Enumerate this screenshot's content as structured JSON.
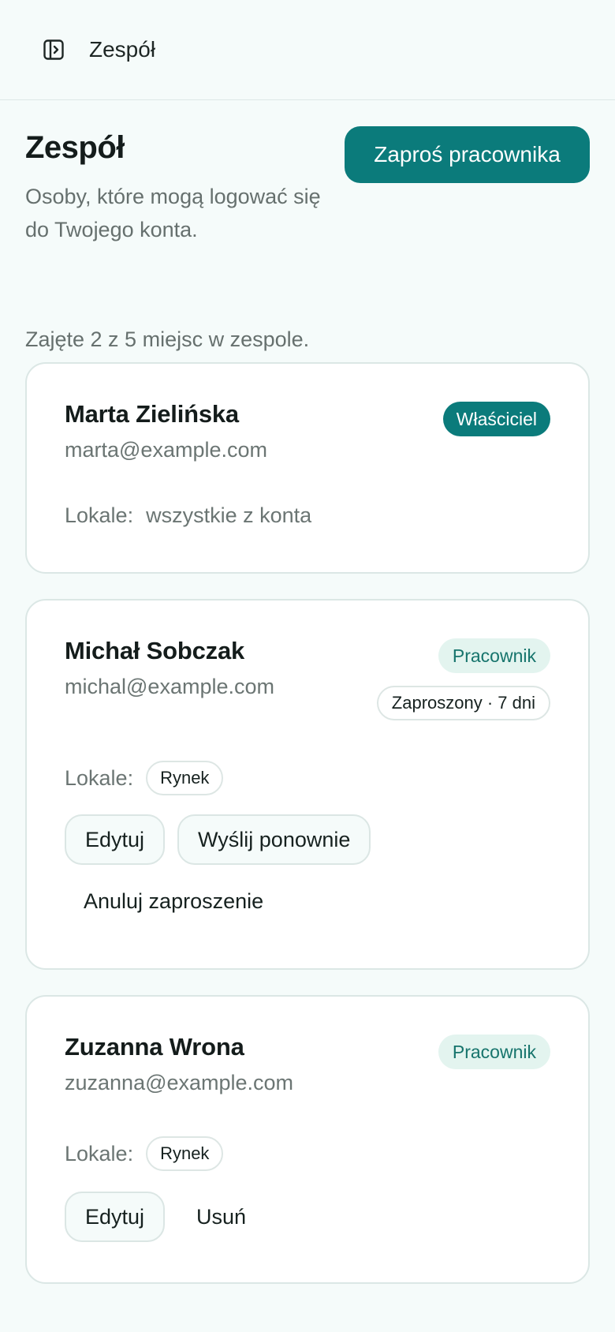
{
  "topbar": {
    "title": "Zespół"
  },
  "header": {
    "title": "Zespół",
    "subtitle": "Osoby, które mogą logować się do Twojego konta.",
    "invite_label": "Zaproś pracownika"
  },
  "seats_text": "Zajęte 2 z 5 miejsc w zespole.",
  "lokale_label": "Lokale:",
  "members": [
    {
      "name": "Marta Zielińska",
      "email": "marta@example.com",
      "role": "Właściciel",
      "lokale": "wszystkie z konta"
    },
    {
      "name": "Michał Sobczak",
      "email": "michal@example.com",
      "role": "Pracownik",
      "status": "Zaproszony · 7 dni",
      "lokale": "Rynek",
      "actions": {
        "edit": "Edytuj",
        "resend": "Wyślij ponownie",
        "cancel": "Anuluj zaproszenie"
      }
    },
    {
      "name": "Zuzanna Wrona",
      "email": "zuzanna@example.com",
      "role": "Pracownik",
      "lokale": "Rynek",
      "actions": {
        "edit": "Edytuj",
        "remove": "Usuń"
      }
    }
  ],
  "colors": {
    "accent": "#0b7b7b",
    "badge_staff_bg": "#e3f4ef",
    "background": "#f5fbfa"
  },
  "icons": {
    "sidebar_toggle": "sidebar-toggle-icon"
  }
}
